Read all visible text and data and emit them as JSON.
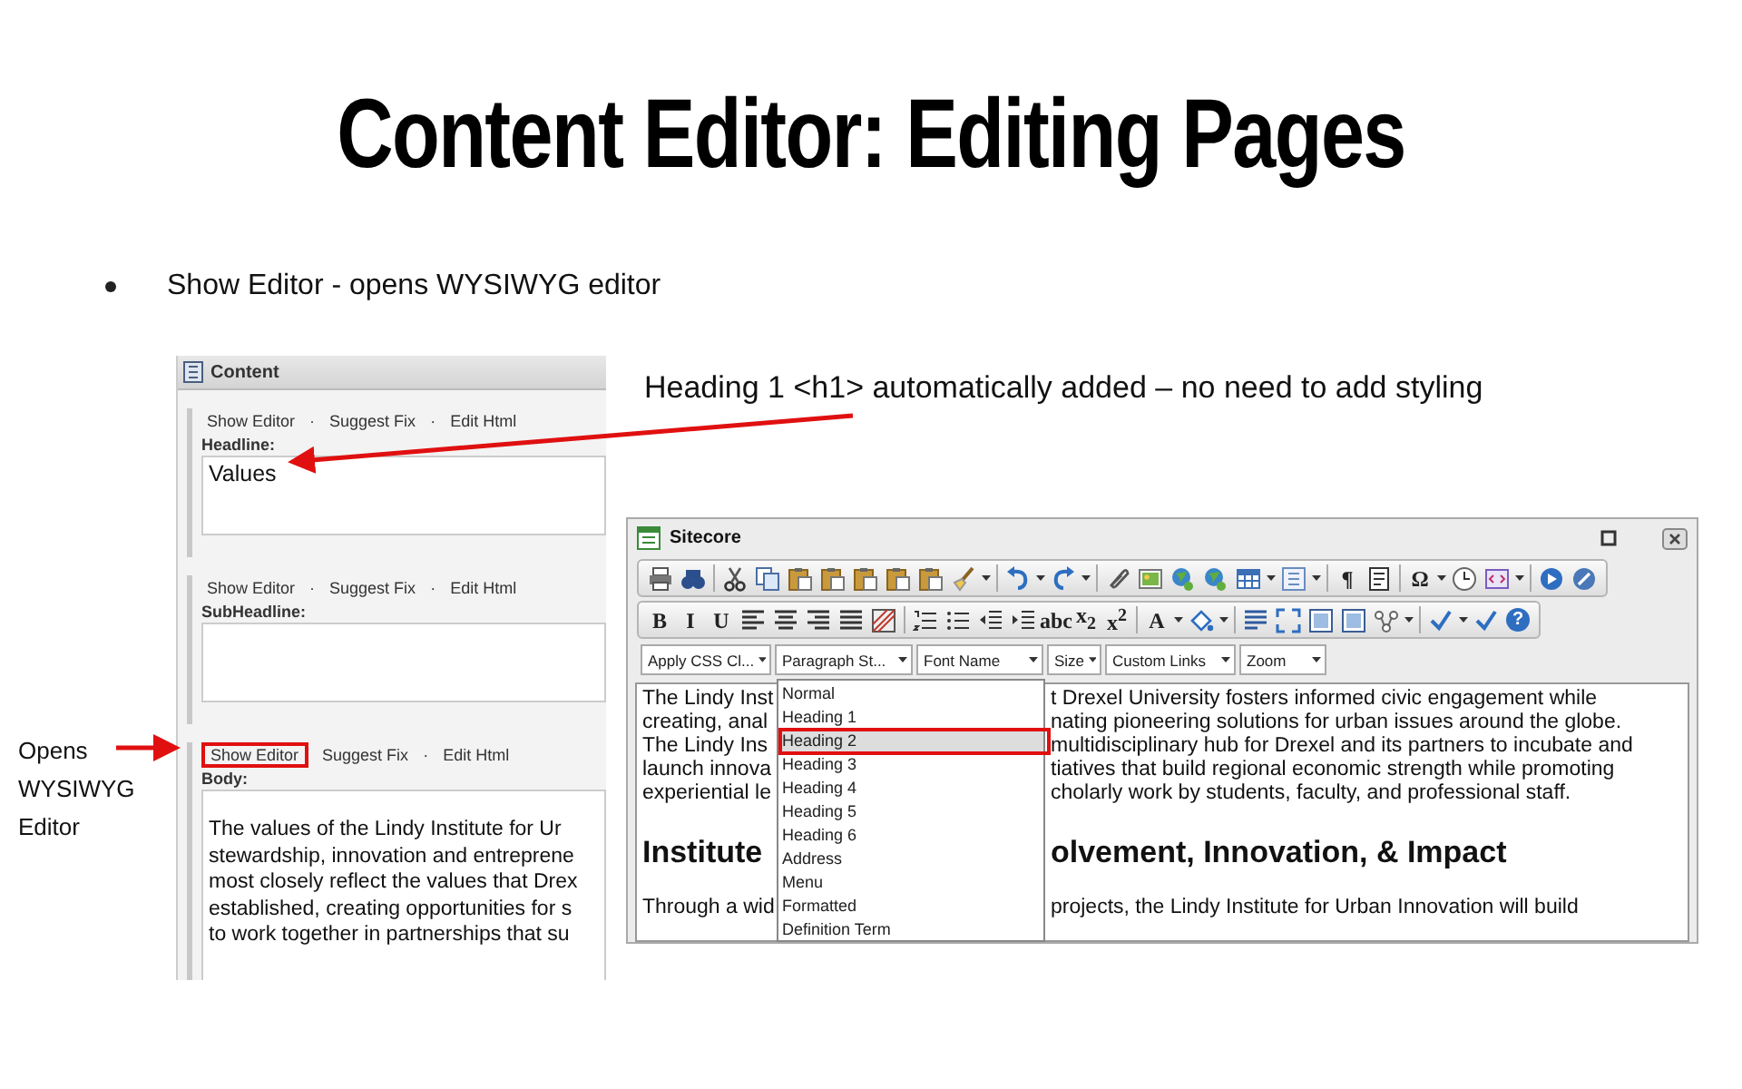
{
  "title": "Content Editor: Editing Pages",
  "bullets": [
    "Show Editor - opens WYSIWYG editor"
  ],
  "callout": "Heading 1 <h1> automatically added – no need to add styling",
  "side_note": "Opens WYSIWYG Editor",
  "content_panel": {
    "title": "Content",
    "fields": [
      {
        "links": [
          {
            "kind": "link",
            "label": "Show Editor",
            "highlighted": false
          },
          {
            "kind": "separator",
            "label": "·"
          },
          {
            "kind": "link",
            "label": "Suggest Fix",
            "highlighted": false
          },
          {
            "kind": "separator",
            "label": "·"
          },
          {
            "kind": "link",
            "label": "Edit Html",
            "highlighted": false
          }
        ],
        "label": "Headline:",
        "value_lines": [
          "Values"
        ],
        "kind": "heading"
      },
      {
        "links": [
          {
            "kind": "link",
            "label": "Show Editor",
            "highlighted": false
          },
          {
            "kind": "separator",
            "label": "·"
          },
          {
            "kind": "link",
            "label": "Suggest Fix",
            "highlighted": false
          },
          {
            "kind": "separator",
            "label": "·"
          },
          {
            "kind": "link",
            "label": "Edit Html",
            "highlighted": false
          }
        ],
        "label": "SubHeadline:",
        "kind": "heading"
      },
      {
        "links": [
          {
            "kind": "link",
            "label": "Show Editor",
            "highlighted": true
          },
          {
            "kind": "link",
            "label": "Suggest Fix",
            "highlighted": false
          },
          {
            "kind": "separator",
            "label": "·"
          },
          {
            "kind": "link",
            "label": "Edit Html",
            "highlighted": false
          }
        ],
        "label": "Body:",
        "kind": "body",
        "value_lines": [
          "The values of the Lindy Institute for Ur",
          "stewardship, innovation and entreprene",
          "most closely reflect the values that Drex",
          "established, creating opportunities for s",
          "to work together in partnerships that su"
        ]
      }
    ]
  },
  "editor_window": {
    "title": "Sitecore",
    "toolbar": {
      "row_1_glyphs": [
        "¶",
        "Ω"
      ],
      "row_2_glyphs": [
        "B",
        "I",
        "U",
        "abc",
        "x$_{2}$",
        "x$^{2}$",
        "A",
        "?"
      ]
    },
    "dropdowns": [
      "Apply CSS Cl...",
      "Paragraph St...",
      "Font Name",
      "Size",
      "Custom Links",
      "Zoom"
    ],
    "content": [
      {
        "kind": "paragraph",
        "left": "The Lindy Inst",
        "right": "t Drexel University fosters informed civic engagement while"
      },
      {
        "kind": "paragraph",
        "left": "creating, anal",
        "right": "nating pioneering solutions for urban issues around the globe."
      },
      {
        "kind": "paragraph",
        "left": "The Lindy Ins",
        "right": "multidisciplinary hub for Drexel and its partners to incubate and"
      },
      {
        "kind": "paragraph",
        "left": "launch innova",
        "right": "tiatives that build regional economic strength while promoting"
      },
      {
        "kind": "paragraph",
        "left": "experiential le",
        "right": "cholarly work by students, faculty, and professional staff."
      },
      {
        "kind": "heading",
        "left": "Institute",
        "right": "olvement, Innovation, & Impact"
      },
      {
        "kind": "paragraph",
        "left": "Through a wid",
        "right": "projects, the Lindy Institute for Urban Innovation will build"
      }
    ],
    "style_menu": {
      "items": [
        {
          "label": "Normal",
          "selected": false
        },
        {
          "label": "Heading 1",
          "selected": false
        },
        {
          "label": "Heading 2",
          "selected": true
        },
        {
          "label": "Heading 3",
          "selected": false
        },
        {
          "label": "Heading 4",
          "selected": false
        },
        {
          "label": "Heading 5",
          "selected": false
        },
        {
          "label": "Heading 6",
          "selected": false
        },
        {
          "label": "Address",
          "selected": false
        },
        {
          "label": "Menu",
          "selected": false
        },
        {
          "label": "Formatted",
          "selected": false
        },
        {
          "label": "Definition Term",
          "selected": false
        }
      ]
    }
  }
}
